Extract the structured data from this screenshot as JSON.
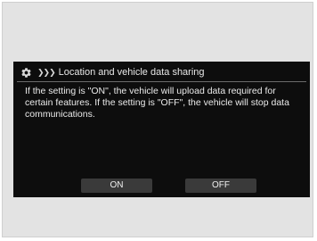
{
  "dialog": {
    "title": "Location and vehicle data sharing",
    "icons": {
      "settings": "gear-icon",
      "breadcrumb": "chevron-right-icon"
    },
    "message": "If the setting is \"ON\", the vehicle will upload data required for certain features. If the setting is \"OFF\", the vehicle will stop data communications.",
    "buttons": {
      "on_label": "ON",
      "off_label": "OFF"
    }
  }
}
